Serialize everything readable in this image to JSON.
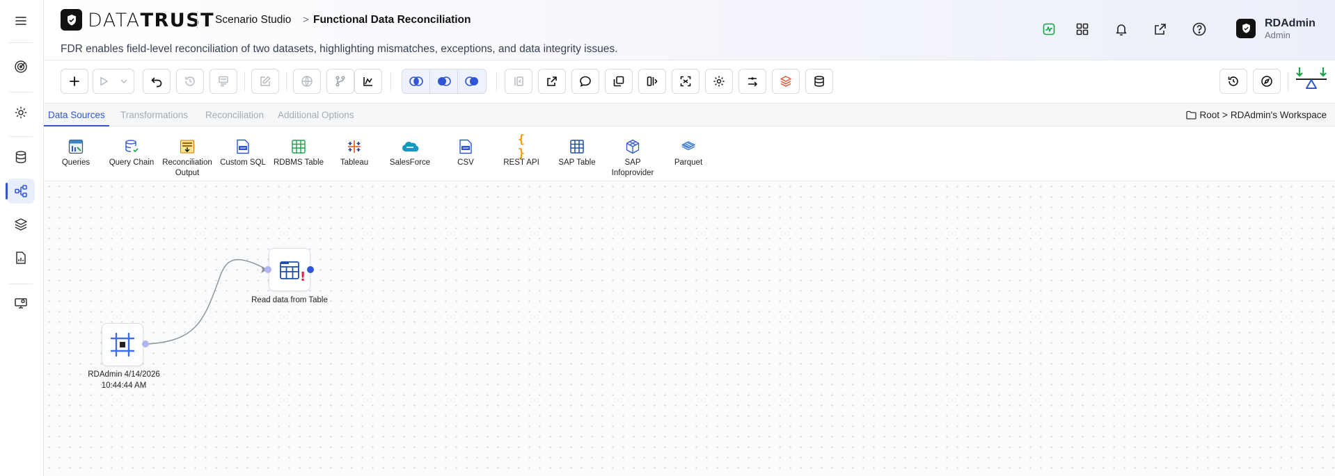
{
  "app": {
    "brand_left": "DATA",
    "brand_right": "TRUST",
    "breadcrumb_parent": "Scenario Studio",
    "breadcrumb_separator": ">",
    "title": "Functional Data Reconciliation",
    "description": "FDR enables field-level reconciliation of two datasets, highlighting mismatches, exceptions, and data integrity issues.",
    "accent_color": "#2f55d4"
  },
  "rail": {
    "items": [
      "menu-icon",
      "target-icon",
      "gear-icon",
      "database-icon",
      "workflow-icon",
      "layers-icon",
      "report-icon",
      "monitor-settings-icon"
    ],
    "active": "workflow-icon"
  },
  "header_icons": [
    "activity-icon",
    "apps-grid-icon",
    "bell-icon",
    "external-link-icon",
    "help-icon"
  ],
  "user": {
    "name": "RDAdmin",
    "role": "Admin"
  },
  "toolbar": {
    "buttons": [
      "add-icon",
      "run-icon",
      "undo-icon",
      "history-icon",
      "schema-icon",
      "edit-icon",
      "globe-icon",
      "branch-icon",
      "chart-icon",
      "join-toggle-icons",
      "first-icon",
      "export-icon",
      "comment-icon",
      "copy-icon",
      "split-icon",
      "fit-view-icon",
      "settings-icon",
      "map-icon",
      "stack-icon",
      "database-icon",
      "restore-icon",
      "compass-icon",
      "reconcile-logo-icon"
    ]
  },
  "tabs": {
    "items": [
      "Data Sources",
      "Transformations",
      "Reconciliation",
      "Additional Options"
    ],
    "active": "Data Sources"
  },
  "workspace_path": {
    "root": "Root",
    "separator": ">",
    "workspace": "RDAdmin's Workspace"
  },
  "palette": {
    "items": [
      {
        "label": "Queries",
        "icon": "queries-icon"
      },
      {
        "label": "Query Chain",
        "icon": "query-chain-icon"
      },
      {
        "label": "Reconciliation Output",
        "icon": "reconciliation-output-icon"
      },
      {
        "label": "Custom SQL",
        "icon": "custom-sql-icon"
      },
      {
        "label": "RDBMS Table",
        "icon": "rdbms-table-icon"
      },
      {
        "label": "Tableau",
        "icon": "tableau-icon"
      },
      {
        "label": "SalesForce",
        "icon": "salesforce-icon"
      },
      {
        "label": "CSV",
        "icon": "csv-icon"
      },
      {
        "label": "REST API",
        "icon": "rest-api-icon"
      },
      {
        "label": "SAP Table",
        "icon": "sap-table-icon"
      },
      {
        "label": "SAP Infoprovider",
        "icon": "sap-infoprovider-icon"
      },
      {
        "label": "Parquet",
        "icon": "parquet-icon"
      }
    ],
    "rest_api_glyph": "{ }"
  },
  "canvas": {
    "nodes": [
      {
        "label": "RDAdmin 4/14/2026 10:44:44 AM",
        "icon": "start-node-icon"
      },
      {
        "label": "Read data from Table",
        "icon": "table-node-icon",
        "status": "!"
      }
    ],
    "edge": {
      "from": "start-node",
      "to": "read-table-node"
    }
  }
}
